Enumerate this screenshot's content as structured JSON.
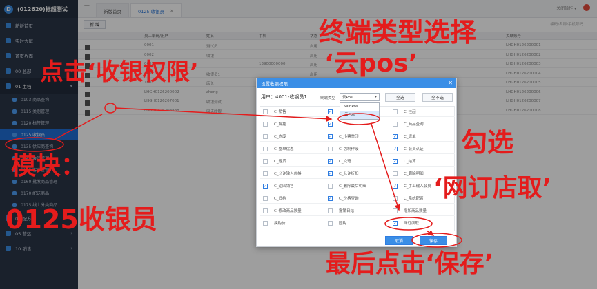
{
  "app": {
    "title": "(012620)标超测试",
    "logo_glyph": "D"
  },
  "sidebar": {
    "items": [
      {
        "label": "新版首页",
        "type": "top"
      },
      {
        "label": "实时大屏",
        "type": "top"
      },
      {
        "label": "首页界面",
        "type": "top"
      },
      {
        "label": "00 总部",
        "type": "top",
        "chevron": "›"
      },
      {
        "label": "01 主档",
        "type": "group",
        "chevron": "▾"
      },
      {
        "label": "0103 商品查询",
        "type": "sub"
      },
      {
        "label": "0115 类别管理",
        "type": "sub"
      },
      {
        "label": "0120 标签管理",
        "type": "sub"
      },
      {
        "label": "0125 收银员",
        "type": "sub",
        "active": true
      },
      {
        "label": "0135 供应商查询",
        "type": "sub"
      },
      {
        "label": "0140 会员管理",
        "type": "sub"
      },
      {
        "label": "0145 客户管理",
        "type": "sub"
      },
      {
        "label": "0160 批发商品管理",
        "type": "sub"
      },
      {
        "label": "0170 配送商品",
        "type": "sub"
      },
      {
        "label": "0175 线上分类商品",
        "type": "sub"
      },
      {
        "label": "03 配方",
        "type": "top",
        "chevron": "›"
      },
      {
        "label": "05 营运",
        "type": "top",
        "chevron": "›"
      },
      {
        "label": "10 销售",
        "type": "top",
        "chevron": "›"
      }
    ]
  },
  "topbar": {
    "tabs": [
      {
        "label": "新版首页",
        "active": false
      },
      {
        "label": "0125 收银员",
        "active": true
      }
    ],
    "close_glyph": "✕",
    "menu_glyph": "☰",
    "right_text": "关闭操作 ▾"
  },
  "toolbar": {
    "new_label": "新 增",
    "search_hint": "编码/名称/手机号码"
  },
  "grid": {
    "headers": [
      "员工编码/用户",
      "姓名",
      "手机",
      "状态",
      "关联账号"
    ],
    "rows": [
      {
        "code": "0001",
        "name": "测试员",
        "phone": "",
        "status": "启用",
        "link": "LHGH0126200001"
      },
      {
        "code": "0002",
        "name": "收银",
        "phone": "",
        "status": "启用",
        "link": "LHGH0126200002"
      },
      {
        "code": "0003",
        "name": "",
        "phone": "13900000000",
        "status": "启用",
        "link": "LHGH0126200003"
      },
      {
        "code": "4001",
        "name": "收银员1",
        "phone": "",
        "status": "启用",
        "link": "LHGH0126200004"
      },
      {
        "code": "1001",
        "name": "店长",
        "phone": "",
        "status": "启用",
        "link": "LHGH0126200005"
      },
      {
        "code": "LHGH0126200002",
        "name": "zheng",
        "phone": "",
        "status": "启用",
        "link": "LHGH0126200006"
      },
      {
        "code": "LHGH0126207001",
        "name": "收银测试",
        "phone": "",
        "status": "启用",
        "link": "LHGH0126200007"
      },
      {
        "code": "LHGH0126208888",
        "name": "网店收银",
        "phone": "",
        "status": "启用",
        "link": "LHGH0126200008"
      }
    ]
  },
  "dialog": {
    "title": "设置收银权限",
    "close_glyph": "✕",
    "user_text": "用户：4001-收银员1",
    "type_label": "终端类型",
    "type_value": "云Pos",
    "dropdown_options": [
      {
        "label": "WinPos",
        "selected": false
      },
      {
        "label": "云Pos",
        "selected": true
      }
    ],
    "select_all": "全选",
    "deselect_all": "全不选",
    "perms": [
      [
        {
          "label": "C_销售",
          "checked": false
        },
        {
          "label": "",
          "checked": true
        },
        {
          "label": "C_挂起",
          "checked": false
        }
      ],
      [
        {
          "label": "C_解挂",
          "checked": false
        },
        {
          "label": "",
          "checked": true
        },
        {
          "label": "C_商品查询",
          "checked": false
        }
      ],
      [
        {
          "label": "C_作废",
          "checked": false
        },
        {
          "label": "C_小票重印",
          "checked": true
        },
        {
          "label": "C_退单",
          "checked": true
        }
      ],
      [
        {
          "label": "C_整单优惠",
          "checked": false
        },
        {
          "label": "C_强制作废",
          "checked": false
        },
        {
          "label": "C_会员认证",
          "checked": true
        }
      ],
      [
        {
          "label": "C_退货",
          "checked": false
        },
        {
          "label": "C_交班",
          "checked": true
        },
        {
          "label": "C_结算",
          "checked": true
        }
      ],
      [
        {
          "label": "C_允许输入价格",
          "checked": false
        },
        {
          "label": "C_允许折扣",
          "checked": true
        },
        {
          "label": "C_删除明细",
          "checked": false
        }
      ],
      [
        {
          "label": "C_返回销售",
          "checked": true
        },
        {
          "label": "C_删除最后明细",
          "checked": false
        },
        {
          "label": "C_手工输入会员",
          "checked": true
        }
      ],
      [
        {
          "label": "C_日结",
          "checked": false
        },
        {
          "label": "C_价格查询",
          "checked": true
        },
        {
          "label": "C_系统配置",
          "checked": false
        }
      ],
      [
        {
          "label": "C_修改商品数量",
          "checked": false
        },
        {
          "label": "撤销日结",
          "checked": false
        },
        {
          "label": "增加商品数量",
          "checked": false
        }
      ],
      [
        {
          "label": "换购价",
          "checked": false
        },
        {
          "label": "团购",
          "checked": false
        },
        {
          "label": "网订店取",
          "checked": true
        }
      ]
    ],
    "cancel_label": "取消",
    "save_label": "保存"
  },
  "annotations": {
    "terminal_type": "终端类型选择",
    "cloud_pos": "‘云pos’",
    "click_perm": "点击‘收银权限’",
    "check": "勾选",
    "net_order": "‘网订店取’",
    "module": "模块：",
    "module_name": "0125收银员",
    "final_save": "最后点击‘保存’"
  },
  "colors": {
    "annotation": "#e41c1c",
    "accent": "#3a8ee6",
    "sidebar": "#2b3648"
  }
}
